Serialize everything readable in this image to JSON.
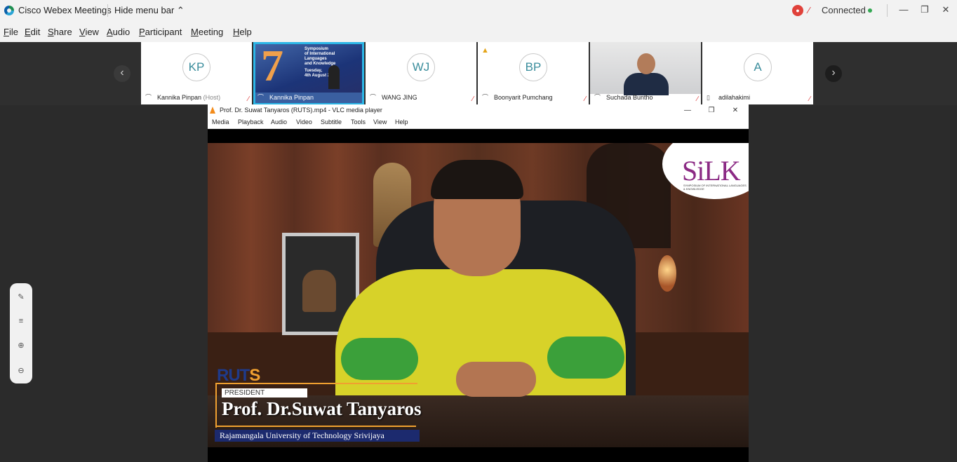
{
  "webex": {
    "app_title": "Cisco Webex Meetings",
    "hide_menu": "Hide menu bar",
    "connection_status": "Connected",
    "menu": [
      "File",
      "Edit",
      "Share",
      "View",
      "Audio",
      "Participant",
      "Meeting",
      "Help"
    ]
  },
  "participants": [
    {
      "initials": "KP",
      "name": "Kannika Pinpan",
      "suffix": "(Host)",
      "type": "avatar"
    },
    {
      "initials": "",
      "name": "Kannika Pinpan",
      "suffix": "",
      "type": "video",
      "active": true
    },
    {
      "initials": "WJ",
      "name": "WANG JING",
      "suffix": "",
      "type": "avatar"
    },
    {
      "initials": "BP",
      "name": "Boonyarit Pumchang",
      "suffix": "",
      "type": "avatar",
      "warning": true
    },
    {
      "initials": "",
      "name": "Suchada Buntho",
      "suffix": "",
      "type": "camera"
    },
    {
      "initials": "A",
      "name": "adilahakimi",
      "suffix": "",
      "type": "avatar"
    }
  ],
  "shared_slide": {
    "number": "7",
    "the": "The",
    "lines": [
      "Symposium",
      "of International",
      "Languages",
      "and Knowledge"
    ],
    "date_line1": "Tuesday,",
    "date_line2": "4th August 2"
  },
  "vlc": {
    "title": "Prof. Dr. Suwat Tanyaros (RUTS).mp4 - VLC media player",
    "menu": [
      "Media",
      "Playback",
      "Audio",
      "Video",
      "Subtitle",
      "Tools",
      "View",
      "Help"
    ]
  },
  "video_overlay": {
    "logo": "RUT",
    "logo_s": "S",
    "role": "PRESIDENT",
    "name": "Prof. Dr.Suwat Tanyaros",
    "university": "Rajamangala University of Technology Srivijaya",
    "silk": "SiLK",
    "silk_sub": "SYMPOSIUM OF INTERNATIONAL LANGUAGES & KNOWLEDGE"
  },
  "icons": {
    "record": "record-icon",
    "mic_muted": "mic-muted-icon",
    "headset": "headset-icon",
    "prev": "chevron-left-icon",
    "next": "chevron-right-icon",
    "annotate": "annotate-icon",
    "zoom_in": "zoom-in-icon",
    "zoom_out": "zoom-out-icon"
  },
  "colors": {
    "active_tile": "#2cb6e6",
    "connected_dot": "#34a853",
    "shirt": "#d7d229",
    "vlc_cone": "#f38b1a"
  }
}
